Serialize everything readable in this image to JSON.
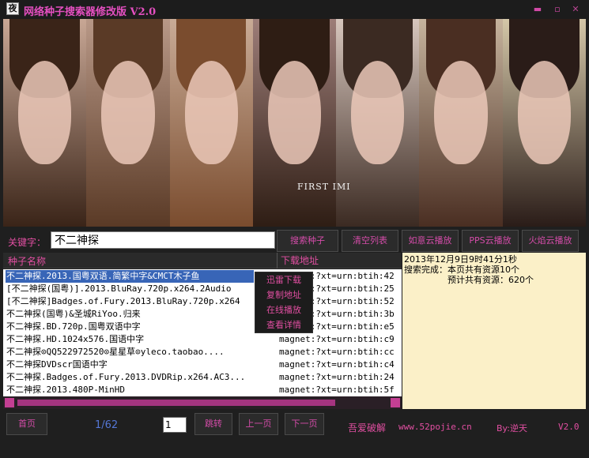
{
  "window": {
    "icon_char": "夜",
    "title": "网络种子搜索器修改版 V2.0",
    "min_symbol": "▬",
    "max_symbol": "▫",
    "close_symbol": "✕"
  },
  "banner": {
    "caption": "FIRST IMI",
    "photos": [
      {
        "hair": "#3a2418",
        "bg": "#c8a795"
      },
      {
        "hair": "#5a3a26",
        "bg": "#b89887"
      },
      {
        "hair": "#7a4c2e",
        "bg": "#c9ab96"
      },
      {
        "hair": "#2e1d14",
        "bg": "#9d7d78"
      },
      {
        "hair": "#3b2a22",
        "bg": "#d7c6bd"
      },
      {
        "hair": "#4a2e22",
        "bg": "#c6b39d"
      },
      {
        "hair": "#2a1c18",
        "bg": "#d4c7a8"
      }
    ]
  },
  "search": {
    "label": "关键字：",
    "value": "不二神探",
    "buttons": [
      "搜索种子",
      "清空列表",
      "如意云播放",
      "PPS云播放",
      "火焰云播放"
    ]
  },
  "list": {
    "col_name": "种子名称",
    "col_url": "下载地址",
    "rows": [
      {
        "name": "不二神探.2013.国粤双语.简繁中字&CMCT木子鱼",
        "url": "magnet:?xt=urn:btih:42",
        "selected": true
      },
      {
        "name": "[不二神探(国粤)].2013.BluRay.720p.x264.2Audio",
        "url": "magnet:?xt=urn:btih:25",
        "selected": false
      },
      {
        "name": "[不二神探]Badges.of.Fury.2013.BluRay.720p.x264",
        "url": "magnet:?xt=urn:btih:52",
        "selected": false
      },
      {
        "name": "不二神探(国粤)&圣城RiYoo.归来",
        "url": "magnet:?xt=urn:btih:3b",
        "selected": false
      },
      {
        "name": "不二神探.BD.720p.国粤双语中字",
        "url": "magnet:?xt=urn:btih:e5",
        "selected": false
      },
      {
        "name": "不二神探.HD.1024x576.国语中字",
        "url": "magnet:?xt=urn:btih:c9",
        "selected": false
      },
      {
        "name": "不二神探⊙QQ522972520⊙星星草⊙yleco.taobao....",
        "url": "magnet:?xt=urn:btih:cc",
        "selected": false
      },
      {
        "name": "不二神探DVDscr国语中字",
        "url": "magnet:?xt=urn:btih:c4",
        "selected": false
      },
      {
        "name": "不二神探.Badges.of.Fury.2013.DVDRip.x264.AC3...",
        "url": "magnet:?xt=urn:btih:24",
        "selected": false
      },
      {
        "name": "不二神探.2013.480P-MinHD",
        "url": "magnet:?xt=urn:btih:5f",
        "selected": false
      }
    ]
  },
  "context_menu": {
    "items": [
      "迅雷下载",
      "复制地址",
      "在线播放",
      "查看详情"
    ]
  },
  "info": {
    "lines": [
      "2013年12月9日9时41分1秒",
      "搜索完成：本页共有资源10个",
      "　　　　　预计共有资源：620个"
    ]
  },
  "footer": {
    "first_label": "首页",
    "page_count": "1/62",
    "page_input": "1",
    "jump_label": "跳转",
    "prev_label": "上一页",
    "next_label": "下一页",
    "forum": "吾爱破解",
    "site": "www.52pojie.cn",
    "author": "By:逆天",
    "version": "V2.0"
  }
}
